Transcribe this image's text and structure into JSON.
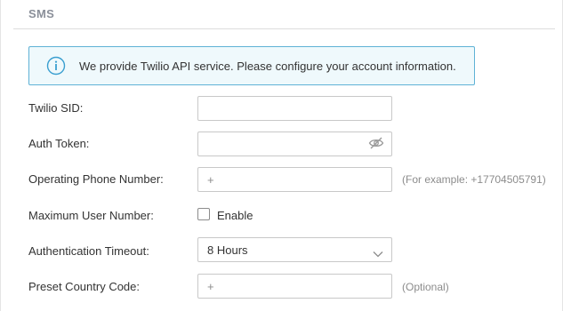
{
  "section": {
    "title": "SMS"
  },
  "banner": {
    "icon": "info-icon",
    "text": "We provide Twilio API service. Please configure your account information."
  },
  "form": {
    "twilio_sid": {
      "label": "Twilio SID:",
      "value": ""
    },
    "auth_token": {
      "label": "Auth Token:",
      "value": "",
      "icon": "eye-slash-icon"
    },
    "operating_phone": {
      "label": "Operating Phone Number:",
      "placeholder": "+",
      "hint": "(For example: +17704505791)"
    },
    "max_user": {
      "label": "Maximum User Number:",
      "checkbox_label": "Enable",
      "checked": false
    },
    "auth_timeout": {
      "label": "Authentication Timeout:",
      "selected": "8 Hours"
    },
    "preset_country_code": {
      "label": "Preset Country Code:",
      "placeholder": "+",
      "hint": "(Optional)"
    }
  },
  "colors": {
    "banner_border": "#5fb2d6",
    "banner_background": "#eff9fc",
    "section_title": "#8a8f99"
  }
}
